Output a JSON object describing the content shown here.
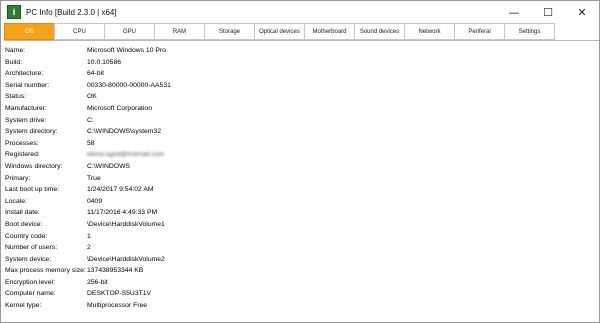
{
  "window": {
    "title": "PC Info [Build 2.3.0 | x64]",
    "minimize_glyph": "—",
    "maximize_glyph": "☐",
    "close_glyph": "✕"
  },
  "tabs": [
    {
      "label": "OS",
      "active": true
    },
    {
      "label": "CPU",
      "active": false
    },
    {
      "label": "GPU",
      "active": false
    },
    {
      "label": "RAM",
      "active": false
    },
    {
      "label": "Storage",
      "active": false
    },
    {
      "label": "Optical devices",
      "active": false
    },
    {
      "label": "Motherboard",
      "active": false
    },
    {
      "label": "Sound devices",
      "active": false
    },
    {
      "label": "Network",
      "active": false
    },
    {
      "label": "Periferal",
      "active": false
    },
    {
      "label": "Settings",
      "active": false
    }
  ],
  "os_info": [
    {
      "label": "Name:",
      "value": "Microsoft Windows 10 Pro"
    },
    {
      "label": "Build:",
      "value": "10.0.10586"
    },
    {
      "label": "Architecture:",
      "value": "64-bit"
    },
    {
      "label": "Serial number:",
      "value": "00330-80000-00000-AA531"
    },
    {
      "label": "Status:",
      "value": "OK"
    },
    {
      "label": "Manufacturer:",
      "value": "Microsoft Corporation"
    },
    {
      "label": "System drive:",
      "value": "C:"
    },
    {
      "label": "System directory:",
      "value": "C:\\WINDOWS\\system32"
    },
    {
      "label": "Processes:",
      "value": "58"
    },
    {
      "label": "Registered:",
      "value": "elena.ogod@hotmail.com"
    },
    {
      "label": "Windows directory:",
      "value": "C:\\WINDOWS"
    },
    {
      "label": "Primary:",
      "value": "True"
    },
    {
      "label": "Last boot up time:",
      "value": "1/24/2017 9:54:02 AM"
    },
    {
      "label": "Locale:",
      "value": "0409"
    },
    {
      "label": "Install date:",
      "value": "11/17/2016 4:49:33 PM"
    },
    {
      "label": "Boot device:",
      "value": "\\Device\\HarddiskVolume1"
    },
    {
      "label": "Country code:",
      "value": "1"
    },
    {
      "label": "Number of users:",
      "value": "2"
    },
    {
      "label": "System device:",
      "value": "\\Device\\HarddiskVolume2"
    },
    {
      "label": "Max process memory size:",
      "value": "137438953344 KB"
    },
    {
      "label": "Encryption level:",
      "value": "256-bit"
    },
    {
      "label": "Computer name:",
      "value": "DESKTOP-S5U3T1V"
    },
    {
      "label": "Kernel type:",
      "value": "Multiprocessor Free"
    }
  ]
}
